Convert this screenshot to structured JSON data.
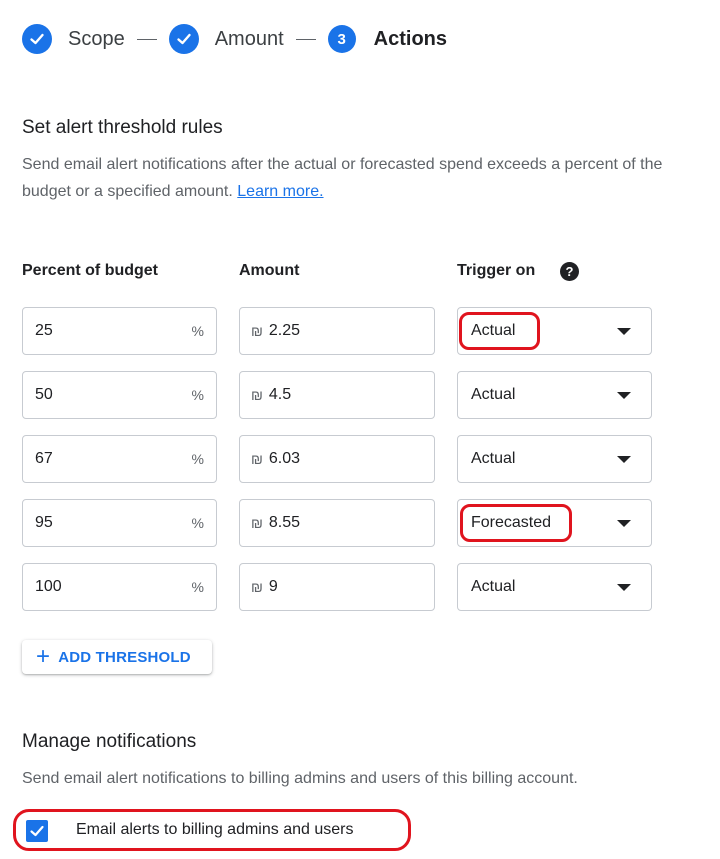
{
  "stepper": {
    "steps": [
      {
        "label": "Scope",
        "state": "done"
      },
      {
        "label": "Amount",
        "state": "done"
      },
      {
        "label": "Actions",
        "number": "3",
        "state": "active"
      }
    ]
  },
  "threshold_section": {
    "title": "Set alert threshold rules",
    "description": "Send email alert notifications after the actual or forecasted spend exceeds a percent of the budget or a specified amount.",
    "learn_more": "Learn more."
  },
  "table": {
    "headers": {
      "percent": "Percent of budget",
      "amount": "Amount",
      "trigger": "Trigger on",
      "help_icon": "?"
    },
    "percent_suffix": "%",
    "currency_symbol": "₪",
    "rows": [
      {
        "percent": "25",
        "amount": "2.25",
        "trigger": "Actual",
        "highlighted": true
      },
      {
        "percent": "50",
        "amount": "4.5",
        "trigger": "Actual",
        "highlighted": false
      },
      {
        "percent": "67",
        "amount": "6.03",
        "trigger": "Actual",
        "highlighted": false
      },
      {
        "percent": "95",
        "amount": "8.55",
        "trigger": "Forecasted",
        "highlighted": true
      },
      {
        "percent": "100",
        "amount": "9",
        "trigger": "Actual",
        "highlighted": false
      }
    ]
  },
  "add_threshold": {
    "icon": "+",
    "label": "ADD THRESHOLD"
  },
  "notifications": {
    "title": "Manage notifications",
    "description": "Send email alert notifications to billing admins and users of this billing account.",
    "checkbox_label": "Email alerts to billing admins and users",
    "checked": true
  },
  "colors": {
    "accent": "#1a73e8",
    "highlight": "#e0141e"
  }
}
